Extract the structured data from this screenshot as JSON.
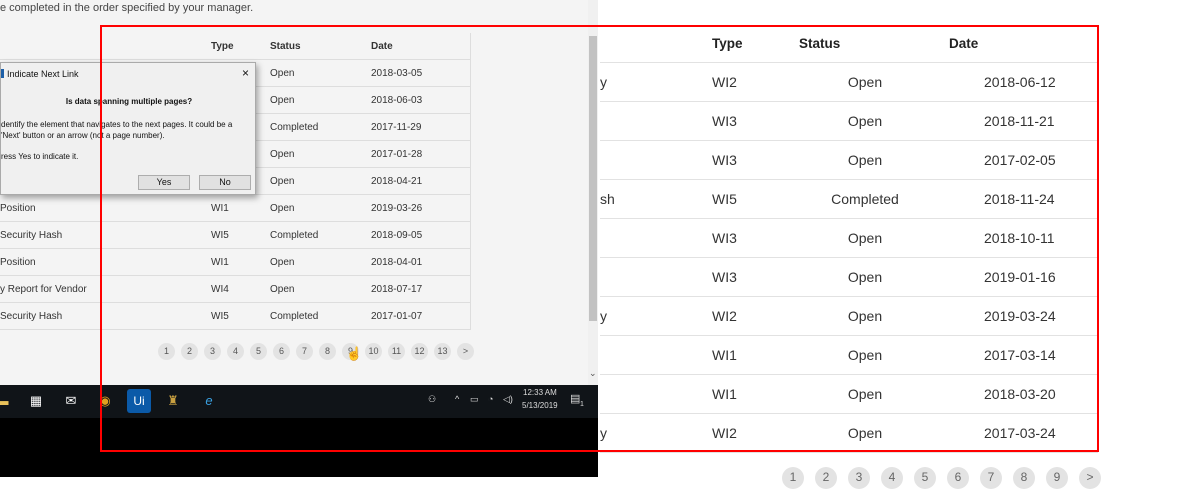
{
  "left_window": {
    "intro": "e completed in the order specified by your manager.",
    "headers": {
      "name": "",
      "type": "Type",
      "status": "Status",
      "date": "Date"
    },
    "rows": [
      {
        "name": "",
        "type": "",
        "status": "Open",
        "date": "2018-03-05"
      },
      {
        "name": "",
        "type": "",
        "status": "Open",
        "date": "2018-06-03"
      },
      {
        "name": "",
        "type": "",
        "status": "Completed",
        "date": "2017-11-29"
      },
      {
        "name": "",
        "type": "",
        "status": "Open",
        "date": "2017-01-28"
      },
      {
        "name": "",
        "type": "",
        "status": "Open",
        "date": "2018-04-21"
      },
      {
        "name": "Position",
        "type": "WI1",
        "status": "Open",
        "date": "2019-03-26"
      },
      {
        "name": "Security Hash",
        "type": "WI5",
        "status": "Completed",
        "date": "2018-09-05"
      },
      {
        "name": "Position",
        "type": "WI1",
        "status": "Open",
        "date": "2018-04-01"
      },
      {
        "name": "y Report for Vendor",
        "type": "WI4",
        "status": "Open",
        "date": "2018-07-17"
      },
      {
        "name": "Security Hash",
        "type": "WI5",
        "status": "Completed",
        "date": "2017-01-07"
      }
    ],
    "pages": [
      "1",
      "2",
      "3",
      "4",
      "5",
      "6",
      "7",
      "8",
      "9",
      "10",
      "11",
      "12",
      "13",
      ">"
    ]
  },
  "dialog": {
    "title": "Indicate Next Link",
    "close": "×",
    "question": "Is data spanning multiple pages?",
    "message": "dentify the element that navigates to the next pages. It could be a 'Next' button or an arrow (not a page number).",
    "message2": "ress Yes to indicate it.",
    "yes": "Yes",
    "no": "No"
  },
  "taskbar": {
    "time": "12:33 AM",
    "date": "5/13/2019",
    "notifications": "1",
    "ui_label": "Ui"
  },
  "right_table": {
    "headers": {
      "name": "",
      "type": "Type",
      "status": "Status",
      "date": "Date"
    },
    "rows": [
      {
        "name": "y",
        "type": "WI2",
        "status": "Open",
        "date": "2018-06-12"
      },
      {
        "name": "",
        "type": "WI3",
        "status": "Open",
        "date": "2018-11-21"
      },
      {
        "name": "",
        "type": "WI3",
        "status": "Open",
        "date": "2017-02-05"
      },
      {
        "name": "sh",
        "type": "WI5",
        "status": "Completed",
        "date": "2018-11-24"
      },
      {
        "name": "",
        "type": "WI3",
        "status": "Open",
        "date": "2018-10-11"
      },
      {
        "name": "",
        "type": "WI3",
        "status": "Open",
        "date": "2019-01-16"
      },
      {
        "name": "y",
        "type": "WI2",
        "status": "Open",
        "date": "2019-03-24"
      },
      {
        "name": "",
        "type": "WI1",
        "status": "Open",
        "date": "2017-03-14"
      },
      {
        "name": "",
        "type": "WI1",
        "status": "Open",
        "date": "2018-03-20"
      },
      {
        "name": "y",
        "type": "WI2",
        "status": "Open",
        "date": "2017-03-24"
      }
    ],
    "pages": [
      "1",
      "2",
      "3",
      "4",
      "5",
      "6",
      "7",
      "8",
      "9",
      ">"
    ]
  },
  "highlight_color": "#ff0000"
}
